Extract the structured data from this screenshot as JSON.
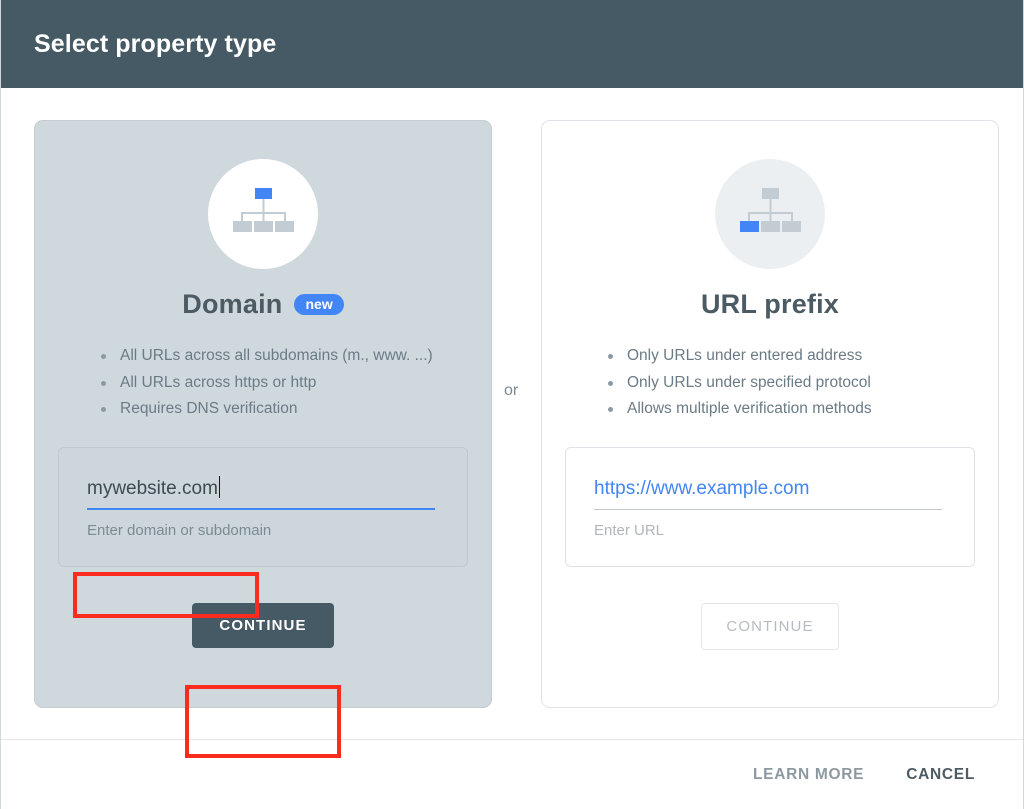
{
  "header": {
    "title": "Select property type"
  },
  "separator": {
    "label": "or"
  },
  "cards": {
    "domain": {
      "title": "Domain",
      "badge": "new",
      "icon": "site-hierarchy-icon",
      "bullets": [
        "All URLs across all subdomains (m., www. ...)",
        "All URLs across https or http",
        "Requires DNS verification"
      ],
      "input": {
        "value": "mywebsite.com",
        "hint": "Enter domain or subdomain"
      },
      "continue_label": "CONTINUE"
    },
    "url_prefix": {
      "title": "URL prefix",
      "icon": "site-hierarchy-icon",
      "bullets": [
        "Only URLs under entered address",
        "Only URLs under specified protocol",
        "Allows multiple verification methods"
      ],
      "input": {
        "placeholder": "https://www.example.com",
        "hint": "Enter URL"
      },
      "continue_label": "CONTINUE"
    }
  },
  "footer": {
    "learn_more_label": "LEARN MORE",
    "cancel_label": "CANCEL"
  },
  "colors": {
    "header_bg": "#455a64",
    "accent_blue": "#4285f4",
    "domain_card_bg": "#cfd8dd",
    "annotation_red": "#fb2c1e",
    "button_dark": "#455a64"
  }
}
